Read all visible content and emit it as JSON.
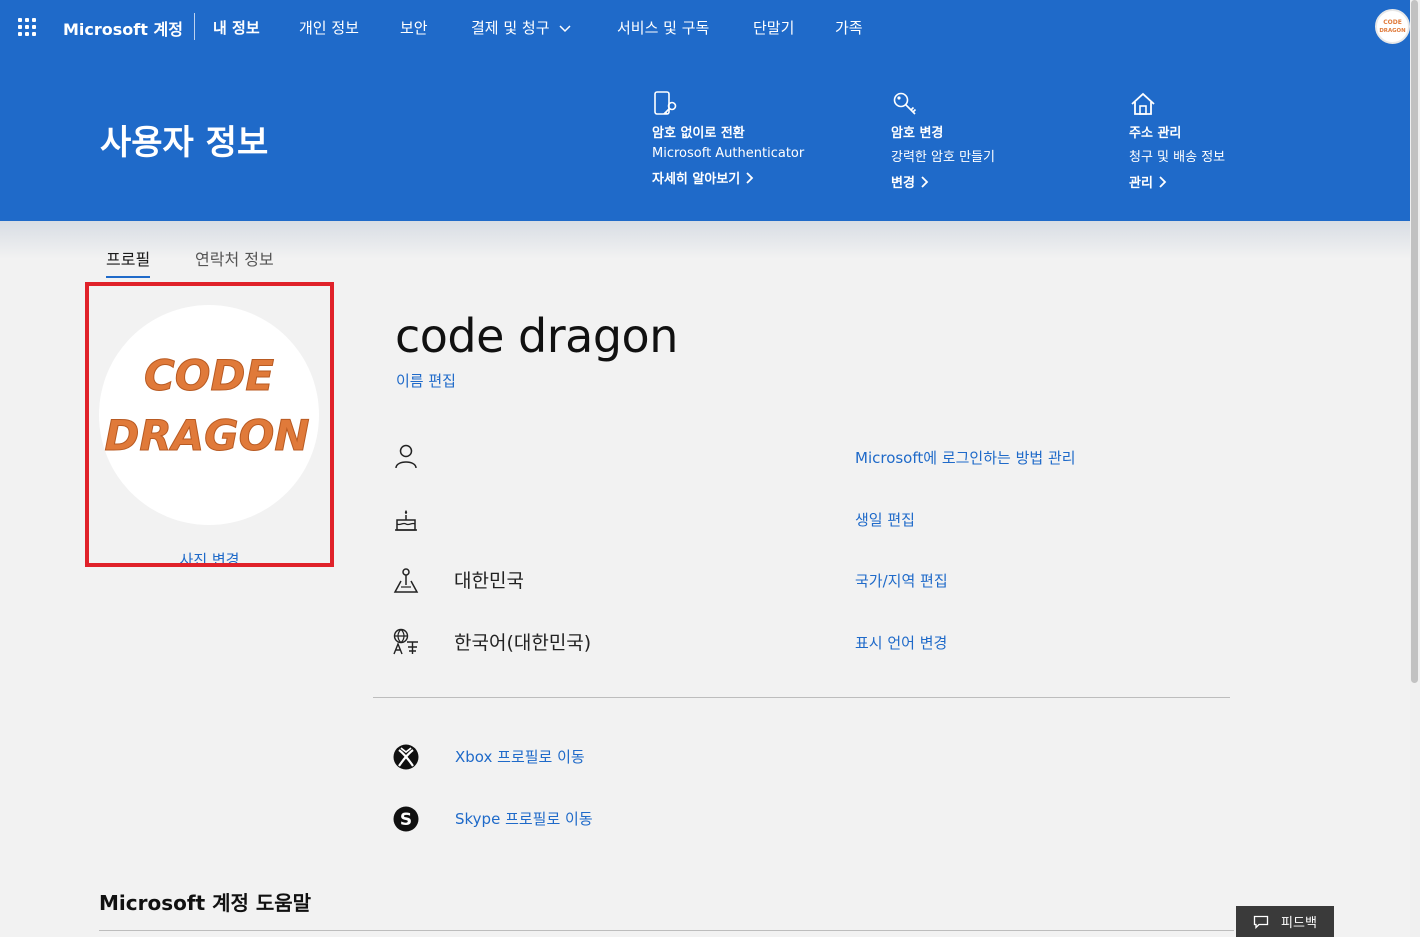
{
  "topnav": {
    "brand": "Microsoft 계정",
    "items": [
      {
        "label": "내 정보"
      },
      {
        "label": "개인 정보"
      },
      {
        "label": "보안"
      },
      {
        "label": "결제 및 청구"
      },
      {
        "label": "서비스 및 구독"
      },
      {
        "label": "단말기"
      },
      {
        "label": "가족"
      }
    ],
    "avatar_text": [
      "CODE",
      "DRAGON"
    ]
  },
  "hero": {
    "title": "사용자 정보",
    "cards": [
      {
        "icon": "phone-key-icon",
        "title": "암호 없이로 전환",
        "subtitle": "Microsoft Authenticator",
        "link": "자세히 알아보기"
      },
      {
        "icon": "key-icon",
        "title": "암호 변경",
        "subtitle": "강력한 암호 만들기",
        "link": "변경"
      },
      {
        "icon": "home-icon",
        "title": "주소 관리",
        "subtitle": "청구 및 배송 정보",
        "link": "관리"
      }
    ]
  },
  "tabs": [
    {
      "label": "프로필",
      "active": true
    },
    {
      "label": "연락처 정보",
      "active": false
    }
  ],
  "profile": {
    "photo_text": [
      "CODE",
      "DRAGON"
    ],
    "photo_link": "사진 변경",
    "name": "code dragon",
    "edit_name": "이름 편집",
    "details": [
      {
        "icon": "person-icon",
        "value": "",
        "link": "Microsoft에 로그인하는 방법 관리"
      },
      {
        "icon": "cake-icon",
        "value": "",
        "link": "생일 편집"
      },
      {
        "icon": "location-icon",
        "value": "대한민국",
        "link": "국가/지역 편집"
      },
      {
        "icon": "language-icon",
        "value": "한국어(대한민국)",
        "link": "표시 언어 변경"
      }
    ],
    "external": [
      {
        "icon": "xbox-icon",
        "link": "Xbox 프로필로 이동"
      },
      {
        "icon": "skype-icon",
        "link": "Skype 프로필로 이동"
      }
    ]
  },
  "help": {
    "title": "Microsoft 계정 도움말"
  },
  "feedback": {
    "label": "피드백"
  },
  "colors": {
    "brand_blue": "#1f6ac9",
    "link_blue": "#1f6ac9",
    "highlight_red": "#e0222a",
    "photo_text_orange": "#e07a3a"
  }
}
